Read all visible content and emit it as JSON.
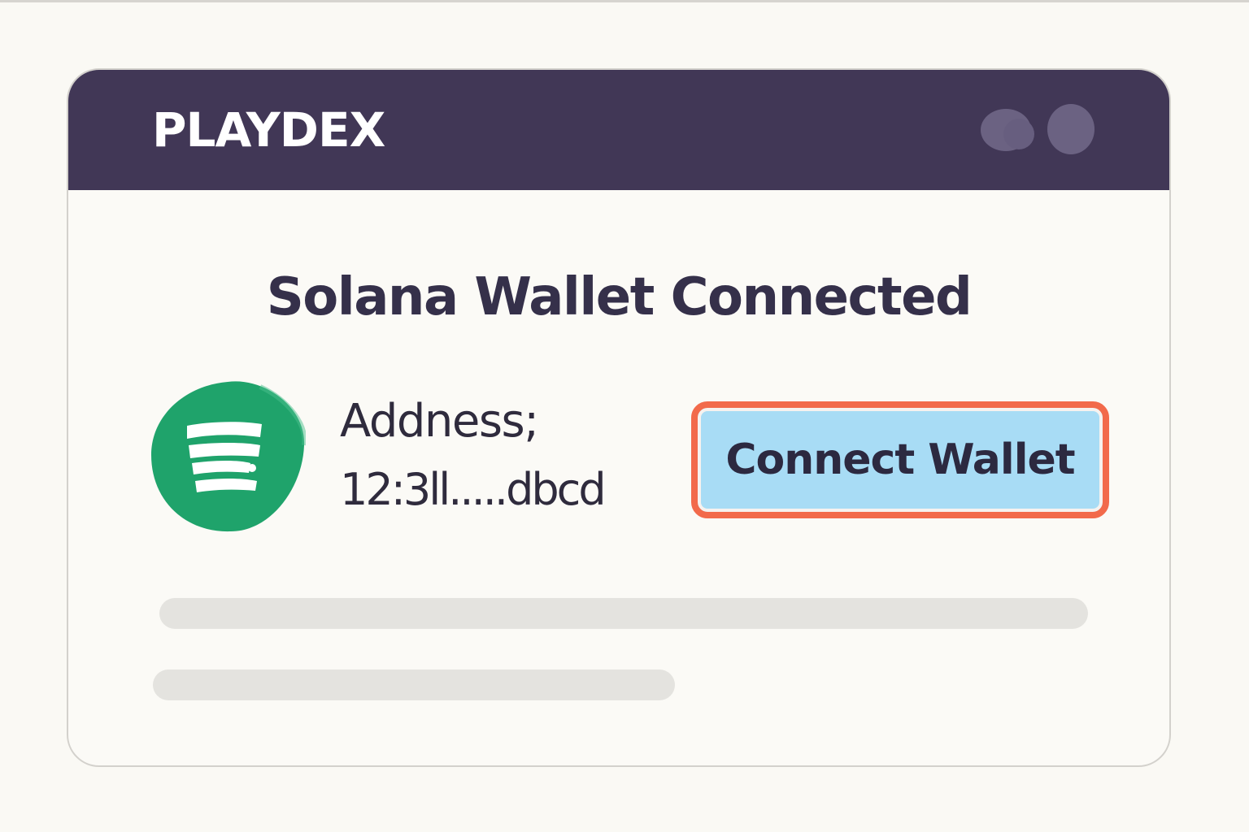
{
  "app": {
    "brand": "PLAYDEX"
  },
  "main": {
    "title": "Solana Wallet Connected",
    "address_label": "Addness;",
    "address_value": "12:3ll.....dbcd",
    "connect_button_label": "Connect Wallet"
  },
  "icons": {
    "wallet": "green-circle-stripes-icon",
    "header_dots": [
      "dot-icon",
      "dot-icon"
    ]
  },
  "colors": {
    "header_bg": "#413756",
    "accent_green": "#1fa36b",
    "button_bg": "#a8dcf5",
    "button_border": "#f26a4b",
    "text_dark": "#35304a"
  }
}
